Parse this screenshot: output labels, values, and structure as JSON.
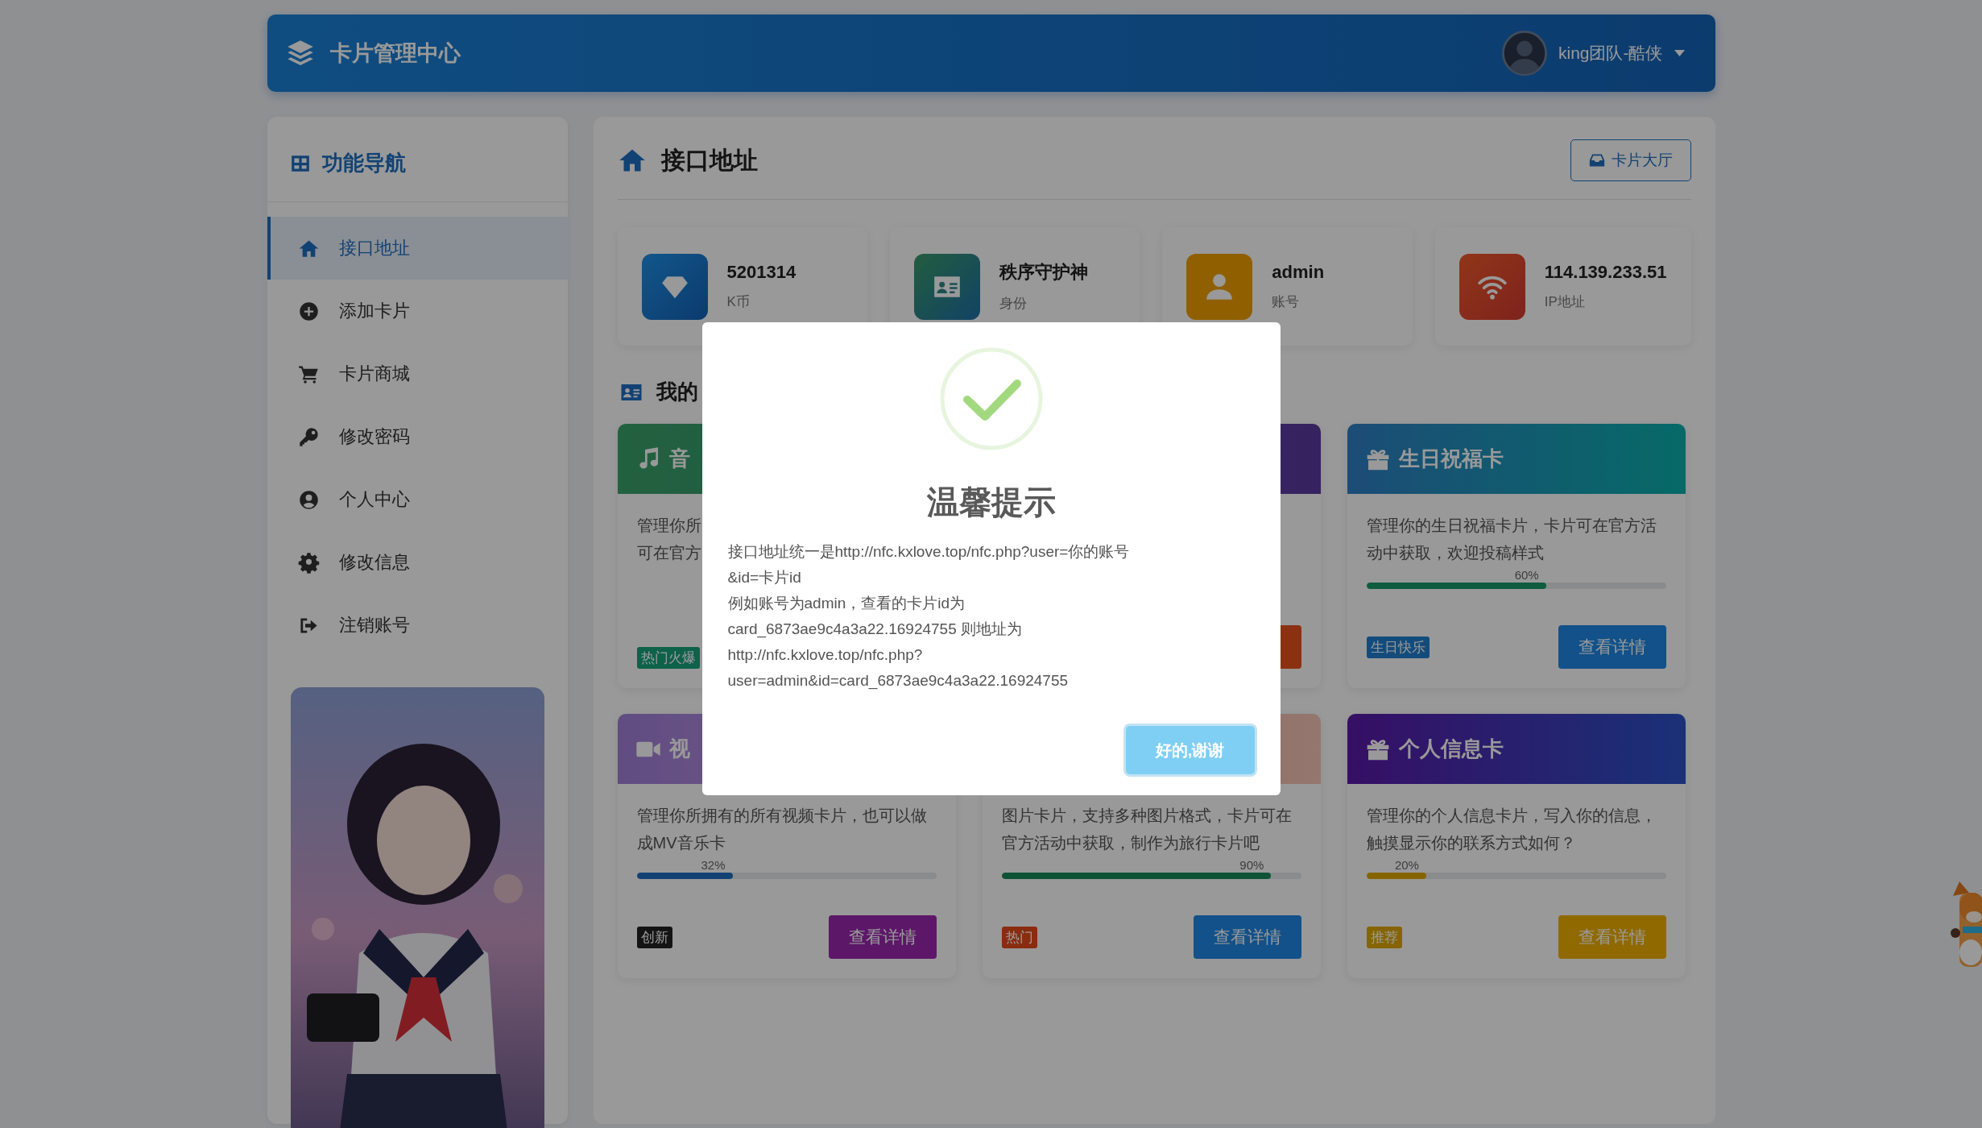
{
  "header": {
    "title": "卡片管理中心",
    "user": "king团队-酷侠"
  },
  "sidebar": {
    "title": "功能导航",
    "items": [
      {
        "label": "接口地址",
        "selected": true
      },
      {
        "label": "添加卡片",
        "selected": false
      },
      {
        "label": "卡片商城",
        "selected": false
      },
      {
        "label": "修改密码",
        "selected": false
      },
      {
        "label": "个人中心",
        "selected": false
      },
      {
        "label": "修改信息",
        "selected": false
      },
      {
        "label": "注销账号",
        "selected": false
      }
    ]
  },
  "page": {
    "title": "接口地址",
    "hall_button": "卡片大厅",
    "section_title": "我的"
  },
  "stats": [
    {
      "value": "5201314",
      "label": "K币"
    },
    {
      "value": "秩序守护神",
      "label": "身份"
    },
    {
      "value": "admin",
      "label": "账号"
    },
    {
      "value": "114.139.233.51",
      "label": "IP地址"
    }
  ],
  "cards": [
    {
      "kind": "clipped",
      "title": "音",
      "description": "管理你所可在官方",
      "tag": {
        "text": "热门火爆"
      }
    },
    {
      "kind": "covered"
    },
    {
      "kind": "full",
      "title": "生日祝福卡",
      "description": "管理你的生日祝福卡片，卡片可在官方活动中获取，欢迎投稿样式",
      "progress": {
        "level": 0.6,
        "reading": "60%"
      },
      "tag": {
        "text": "生日快乐"
      },
      "button": {
        "text": "查看详情"
      }
    },
    {
      "kind": "full",
      "title": "视",
      "description": "管理你所拥有的所有视频卡片，也可以做成MV音乐卡",
      "progress": {
        "level": 0.32,
        "reading": "32%"
      },
      "tag": {
        "text": "创新"
      },
      "button": {
        "text": "查看详情"
      }
    },
    {
      "kind": "full",
      "description": "图片卡片，支持多种图片格式，卡片可在官方活动中获取，制作为旅行卡片吧",
      "progress": {
        "level": 0.9,
        "reading": "90%"
      },
      "tag": {
        "text": "热门"
      },
      "button": {
        "text": "查看详情"
      }
    },
    {
      "kind": "full",
      "title": "个人信息卡",
      "description": "管理你的个人信息卡片，写入你的信息，触摸显示你的联系方式如何？",
      "progress": {
        "level": 0.2,
        "reading": "20%"
      },
      "tag": {
        "text": "推荐"
      },
      "button": {
        "text": "查看详情"
      }
    }
  ],
  "modal": {
    "title": "温馨提示",
    "lines": [
      "接口地址统一是http://nfc.kxlove.top/nfc.php?user=你的账号",
      "&id=卡片id",
      "例如账号为admin，查看的卡片id为",
      "card_6873ae9c4a3a22.16924755 则地址为",
      "http://nfc.kxlove.top/nfc.php?",
      "user=admin&id=card_6873ae9c4a3a22.16924755"
    ],
    "button": "好的,谢谢"
  }
}
